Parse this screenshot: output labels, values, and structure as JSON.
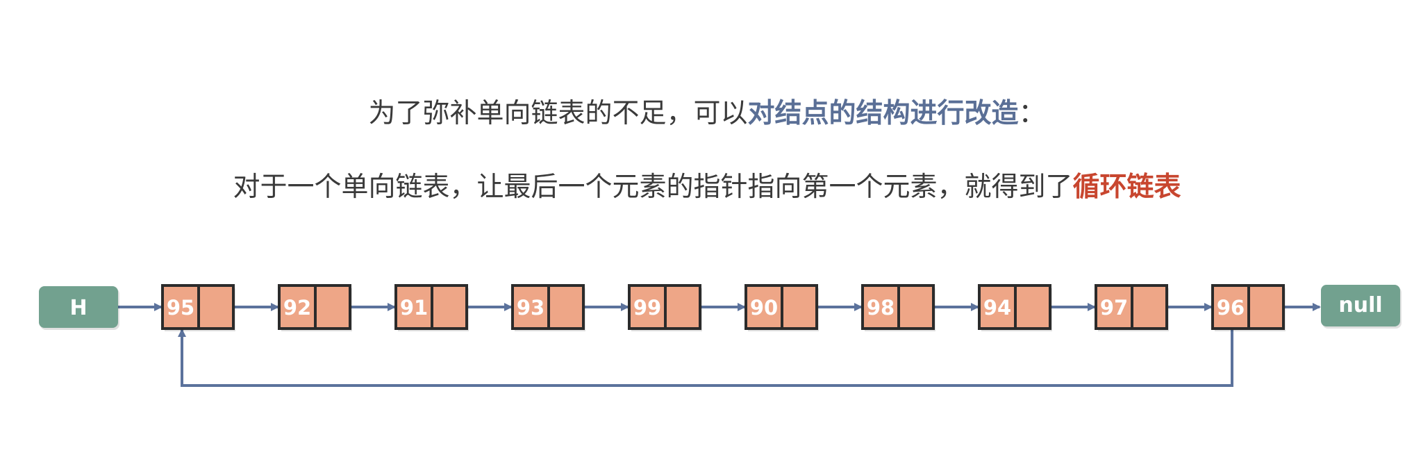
{
  "text": {
    "line1_prefix": "为了弥补单向链表的不足，可以",
    "line1_highlight": "对结点的结构进行改造",
    "line1_suffix": "：",
    "line2_prefix": "对于一个单向链表，让最后一个元素的指针指向第一个元素，就得到了",
    "line2_highlight": "循环链表"
  },
  "diagram": {
    "head_label": "H",
    "tail_label": "null",
    "nodes": [
      95,
      92,
      91,
      93,
      99,
      90,
      98,
      94,
      97,
      96
    ]
  },
  "colors": {
    "terminal_fill": "#72a18f",
    "node_fill": "#eea687",
    "node_border": "#2b2b2b",
    "arrow": "#5b729c",
    "highlight_blue": "#5a6f96",
    "highlight_red": "#c8462f"
  }
}
